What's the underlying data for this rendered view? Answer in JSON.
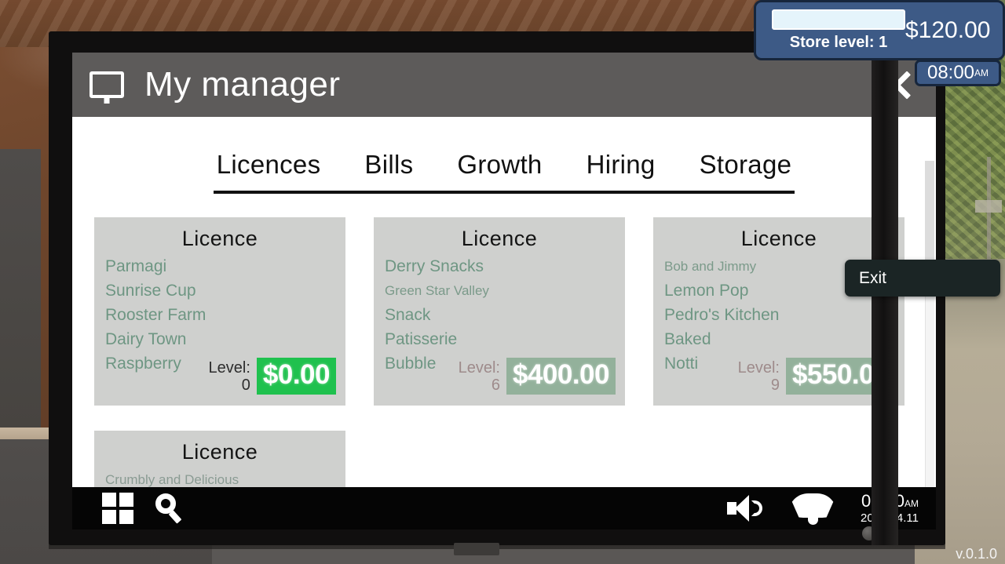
{
  "hud": {
    "money": "$120.00",
    "store_level": "Store level: 1",
    "clock_time": "08:00",
    "clock_meridiem": "AM"
  },
  "window": {
    "title": "My manager",
    "icon": "monitor-icon",
    "close_icon": "close-icon"
  },
  "tabs": [
    {
      "label": "Licences",
      "active": true
    },
    {
      "label": "Bills",
      "active": false
    },
    {
      "label": "Growth",
      "active": false
    },
    {
      "label": "Hiring",
      "active": false
    },
    {
      "label": "Storage",
      "active": false
    }
  ],
  "cards": [
    {
      "title": "Licence",
      "items": [
        "Parmagi",
        "Sunrise Cup",
        "Rooster Farm",
        "Dairy Town",
        "Raspberry"
      ],
      "small_items": [],
      "level_label": "Level:",
      "level_value": "0",
      "price": "$0.00",
      "variant": "active",
      "price_color": "#1fc14e"
    },
    {
      "title": "Licence",
      "items": [
        "Derry Snacks",
        "Snack",
        "Patisserie",
        "Bubble"
      ],
      "small_items": [
        "Green Star Valley"
      ],
      "level_label": "Level:",
      "level_value": "6",
      "price": "$400.00",
      "variant": "muted",
      "price_color": "#93b19b"
    },
    {
      "title": "Licence",
      "items": [
        "Bob and Jimmy",
        "Lemon Pop",
        "Pedro's Kitchen",
        "Baked",
        "Notti"
      ],
      "small_items": [],
      "level_label": "Level:",
      "level_value": "9",
      "price": "$550.00",
      "variant": "muted",
      "price_color": "#93b19b"
    }
  ],
  "partial_card": {
    "title": "Licence",
    "items": [
      "Crumbly and Delicious"
    ]
  },
  "tooltip": {
    "label": "Exit"
  },
  "taskbar": {
    "start_icon": "grid-icon",
    "search_icon": "search-icon",
    "volume_icon": "speaker-icon",
    "wifi_icon": "wifi-icon",
    "time": "08:00",
    "meridiem": "AM",
    "date": "2024.04.11"
  },
  "footer": {
    "version": "v.0.1.0"
  }
}
